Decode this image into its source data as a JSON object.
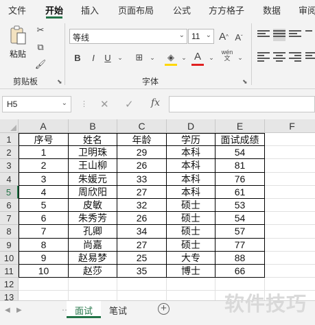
{
  "menu_tabs": [
    "文件",
    "开始",
    "插入",
    "页面布局",
    "公式",
    "方方格子",
    "数据",
    "审阅"
  ],
  "ribbon": {
    "clipboard": {
      "paste_label": "粘贴",
      "group_label": "剪贴板"
    },
    "font": {
      "font_name": "等线",
      "font_size": "11",
      "group_label": "字体",
      "phonetic_glyph": "wén"
    },
    "accent_color": "#217346",
    "font_color": "#e02020",
    "fill_color": "#ffd700"
  },
  "formula_bar": {
    "name_box": "H5",
    "fx_label": "fx"
  },
  "grid": {
    "columns": [
      "A",
      "B",
      "C",
      "D",
      "E",
      "F"
    ],
    "rows": [
      "1",
      "2",
      "3",
      "4",
      "5",
      "6",
      "7",
      "8",
      "9",
      "10",
      "11",
      "12",
      "13"
    ],
    "selected_row": "5",
    "header": [
      "序号",
      "姓名",
      "年龄",
      "学历",
      "面试成绩"
    ],
    "data": [
      [
        "1",
        "卫明珠",
        "29",
        "本科",
        "54"
      ],
      [
        "2",
        "王山柳",
        "26",
        "本科",
        "81"
      ],
      [
        "3",
        "朱媛元",
        "33",
        "本科",
        "76"
      ],
      [
        "4",
        "周欣阳",
        "27",
        "本科",
        "61"
      ],
      [
        "5",
        "皮敏",
        "32",
        "硕士",
        "53"
      ],
      [
        "6",
        "朱秀芳",
        "26",
        "硕士",
        "54"
      ],
      [
        "7",
        "孔卿",
        "34",
        "硕士",
        "57"
      ],
      [
        "8",
        "尚嘉",
        "27",
        "硕士",
        "77"
      ],
      [
        "9",
        "赵易梦",
        "25",
        "大专",
        "88"
      ],
      [
        "10",
        "赵莎",
        "35",
        "博士",
        "66"
      ]
    ]
  },
  "sheets": [
    "面试",
    "笔试"
  ],
  "active_sheet": "面试",
  "watermark": "软件技巧"
}
